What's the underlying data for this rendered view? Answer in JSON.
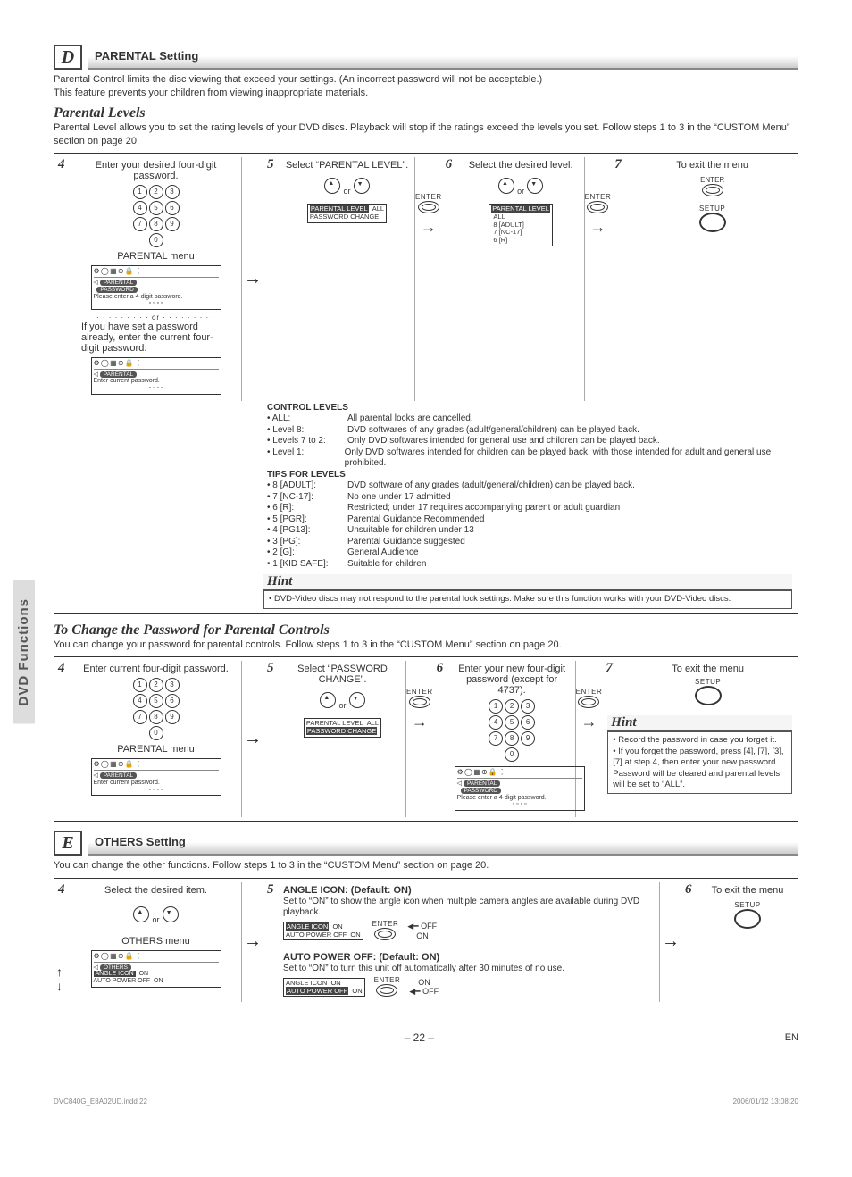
{
  "side_tab": "DVD Functions",
  "sectionD": {
    "letter": "D",
    "title": "PARENTAL Setting",
    "intro1": "Parental Control limits the disc viewing that exceed your settings. (An incorrect password will not be acceptable.)",
    "intro2": "This feature prevents your children from viewing inappropriate materials.",
    "sub1_head": "Parental Levels",
    "sub1_text": "Parental Level allows you to set the rating levels of your DVD discs. Playback will stop if the ratings exceed the levels you set. Follow steps 1 to 3 in the “CUSTOM Menu” section on page 20.",
    "step4": {
      "n": "4",
      "text": "Enter your desired four-digit password.",
      "menu_label": "PARENTAL menu",
      "or_line": "or",
      "alt_text": "If you have set a password already, enter the current four-digit password."
    },
    "step5": {
      "n": "5",
      "text": "Select “PARENTAL LEVEL”.",
      "or": "or",
      "enter": "ENTER",
      "menu": {
        "l1": "PARENTAL LEVEL",
        "v1": "ALL",
        "l2": "PASSWORD CHANGE"
      }
    },
    "step6": {
      "n": "6",
      "text": "Select the desired level.",
      "or": "or",
      "enter": "ENTER",
      "menu": {
        "l1": "PARENTAL LEVEL",
        "o1": "ALL",
        "o2": "8 [ADULT]",
        "o3": "7 [NC-17]",
        "o4": "6 [R]"
      }
    },
    "step7": {
      "n": "7",
      "text": "To exit the menu",
      "enter": "ENTER",
      "setup": "SETUP"
    },
    "control_levels": {
      "title": "CONTROL LEVELS",
      "rows": [
        {
          "k": "• ALL:",
          "v": "All parental locks are cancelled."
        },
        {
          "k": "• Level 8:",
          "v": "DVD softwares of any grades (adult/general/children) can be played back."
        },
        {
          "k": "• Levels 7 to 2:",
          "v": "Only DVD softwares intended for general use and children can be played back."
        },
        {
          "k": "• Level 1:",
          "v": "Only DVD softwares intended for children can be played back, with those intended for adult and general use prohibited."
        }
      ]
    },
    "tips": {
      "title": "TIPS FOR LEVELS",
      "rows": [
        {
          "k": "• 8 [ADULT]:",
          "v": "DVD software of any grades (adult/general/children) can be played back."
        },
        {
          "k": "• 7 [NC-17]:",
          "v": "No one under 17 admitted"
        },
        {
          "k": "• 6 [R]:",
          "v": "Restricted; under 17 requires accompanying parent or adult guardian"
        },
        {
          "k": "• 5 [PGR]:",
          "v": "Parental Guidance Recommended"
        },
        {
          "k": "• 4 [PG13]:",
          "v": "Unsuitable for children under 13"
        },
        {
          "k": "• 3 [PG]:",
          "v": "Parental Guidance suggested"
        },
        {
          "k": "• 2 [G]:",
          "v": "General Audience"
        },
        {
          "k": "• 1 [KID SAFE]:",
          "v": "Suitable for children"
        }
      ]
    },
    "hint": {
      "title": "Hint",
      "text": "• DVD-Video discs may not respond to the parental lock settings. Make sure this function works with your DVD-Video discs."
    },
    "screen1": {
      "title": "PARENTAL",
      "row": "PASSWORD",
      "prompt": "Please enter a 4-digit password."
    },
    "screen2": {
      "title": "PARENTAL",
      "prompt": "Enter current password."
    }
  },
  "change_pw": {
    "head": "To Change the Password for Parental Controls",
    "text": "You can change your password for parental controls. Follow steps 1 to 3 in the “CUSTOM Menu” section on page 20.",
    "step4": {
      "n": "4",
      "text": "Enter current four-digit password.",
      "menu_label": "PARENTAL menu"
    },
    "step5": {
      "n": "5",
      "text": "Select “PASSWORD CHANGE”.",
      "or": "or",
      "enter": "ENTER",
      "menu": {
        "l1": "PARENTAL LEVEL",
        "v1": "ALL",
        "l2": "PASSWORD CHANGE"
      }
    },
    "step6": {
      "n": "6",
      "text": "Enter your new four-digit password (except for 4737).",
      "enter": "ENTER"
    },
    "step7": {
      "n": "7",
      "text": "To exit the menu",
      "setup": "SETUP"
    },
    "hint": {
      "title": "Hint",
      "b1": "• Record the password in case you forget it.",
      "b2": "• If you forget the password, press [4], [7], [3], [7] at step 4, then enter your new password. Password will be cleared and parental levels will be set to “ALL”."
    },
    "screen4": {
      "title": "PARENTAL",
      "prompt": "Enter current password."
    },
    "screen6": {
      "title": "PARENTAL",
      "row": "PASSWORD",
      "prompt": "Please enter a 4-digit password."
    }
  },
  "sectionE": {
    "letter": "E",
    "title": "OTHERS Setting",
    "intro": "You can change the other functions. Follow steps 1 to 3 in the “CUSTOM Menu” section on page 20.",
    "step4": {
      "n": "4",
      "text": "Select the desired item.",
      "or": "or",
      "menu_label": "OTHERS menu"
    },
    "step5": {
      "n": "5",
      "angle": {
        "label": "ANGLE ICON:",
        "def": "(Default: ON)",
        "desc": "Set to “ON” to show the angle icon when multiple camera angles are available during DVD playback.",
        "menu_l1": "ANGLE ICON",
        "menu_v1": "ON",
        "menu_l2": "AUTO POWER OFF",
        "menu_v2": "ON",
        "opt_on": "ON",
        "opt_off": "OFF",
        "enter": "ENTER"
      },
      "auto": {
        "label": "AUTO POWER OFF:",
        "def": "(Default: ON)",
        "desc": "Set to “ON” to turn this unit off automatically after 30 minutes of no use.",
        "menu_l1": "ANGLE ICON",
        "menu_v1": "ON",
        "menu_l2": "AUTO POWER OFF",
        "menu_v2": "ON",
        "opt_on": "ON",
        "opt_off": "OFF",
        "enter": "ENTER"
      }
    },
    "step6": {
      "n": "6",
      "text": "To exit the menu",
      "setup": "SETUP"
    },
    "screen": {
      "title": "OTHERS",
      "r1": "ANGLE ICON",
      "v1": "ON",
      "r2": "AUTO POWER OFF",
      "v2": "ON"
    }
  },
  "footer": {
    "page": "– 22 –",
    "lang": "EN"
  },
  "printline": {
    "left": "DVC840G_E8A02UD.indd   22",
    "right": "2006/01/12   13:08:20"
  }
}
